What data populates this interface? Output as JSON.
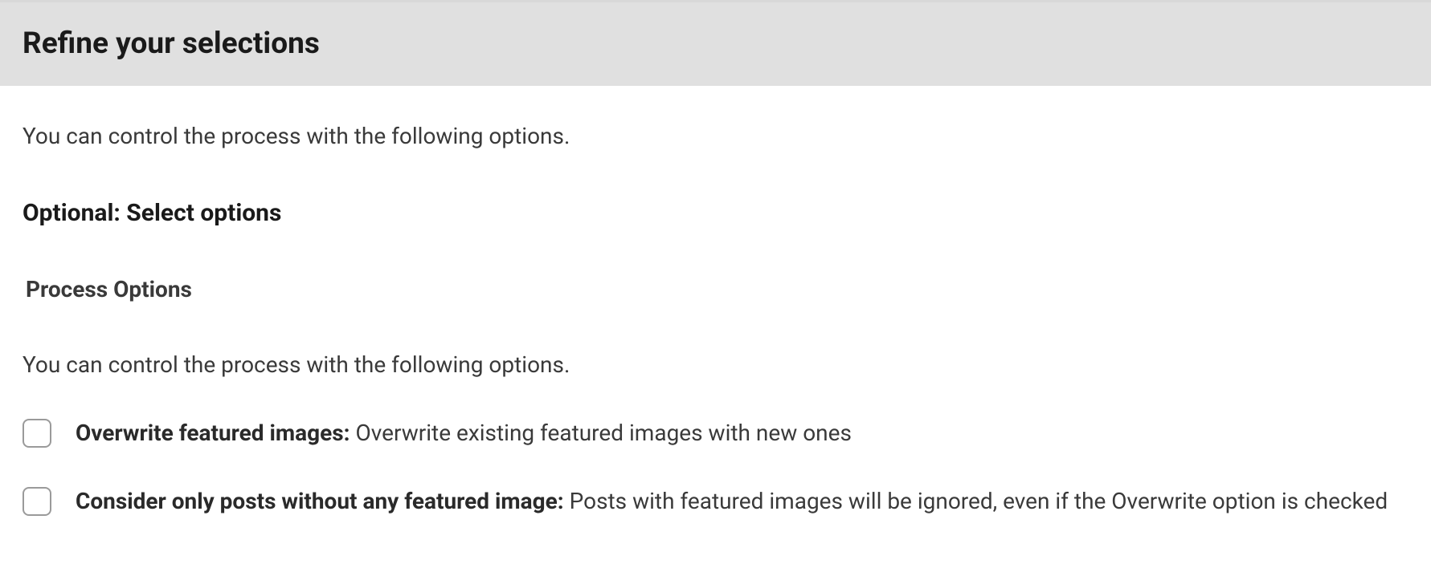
{
  "header": {
    "title": "Refine your selections"
  },
  "intro": "You can control the process with the following options.",
  "subheading": "Optional: Select options",
  "section": {
    "title": "Process Options",
    "desc": "You can control the process with the following options."
  },
  "options": [
    {
      "label": "Overwrite featured images:",
      "desc": " Overwrite existing featured images with new ones"
    },
    {
      "label": "Consider only posts without any featured image:",
      "desc": " Posts with featured images will be ignored, even if the Overwrite option is checked"
    }
  ]
}
